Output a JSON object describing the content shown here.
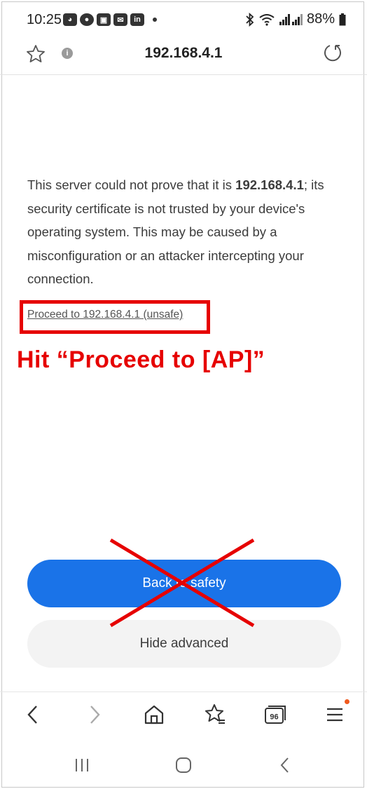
{
  "status_bar": {
    "time": "10:25",
    "app_icons": [
      "discord-icon",
      "chat-icon",
      "gallery-icon",
      "email-icon",
      "linkedin-icon"
    ],
    "app_icon_text": "in",
    "battery": "88%"
  },
  "address_bar": {
    "url": "192.168.4.1"
  },
  "content": {
    "message_prefix": "This server could not prove that it is ",
    "message_host": "192.168.4.1",
    "message_suffix": "; its security certificate is not trusted by your device's operating system. This may be caused by a misconfiguration or an attacker intercepting your connection.",
    "proceed_link": "Proceed to 192.168.4.1 (unsafe)",
    "annotation": "Hit “Proceed to [AP]”",
    "back_button": "Back to safety",
    "hide_button": "Hide advanced"
  },
  "toolbar": {
    "tabs_count": "96"
  },
  "colors": {
    "accent": "#1a73e8",
    "annotation_red": "#e60000",
    "menu_badge": "#f05a1e"
  }
}
